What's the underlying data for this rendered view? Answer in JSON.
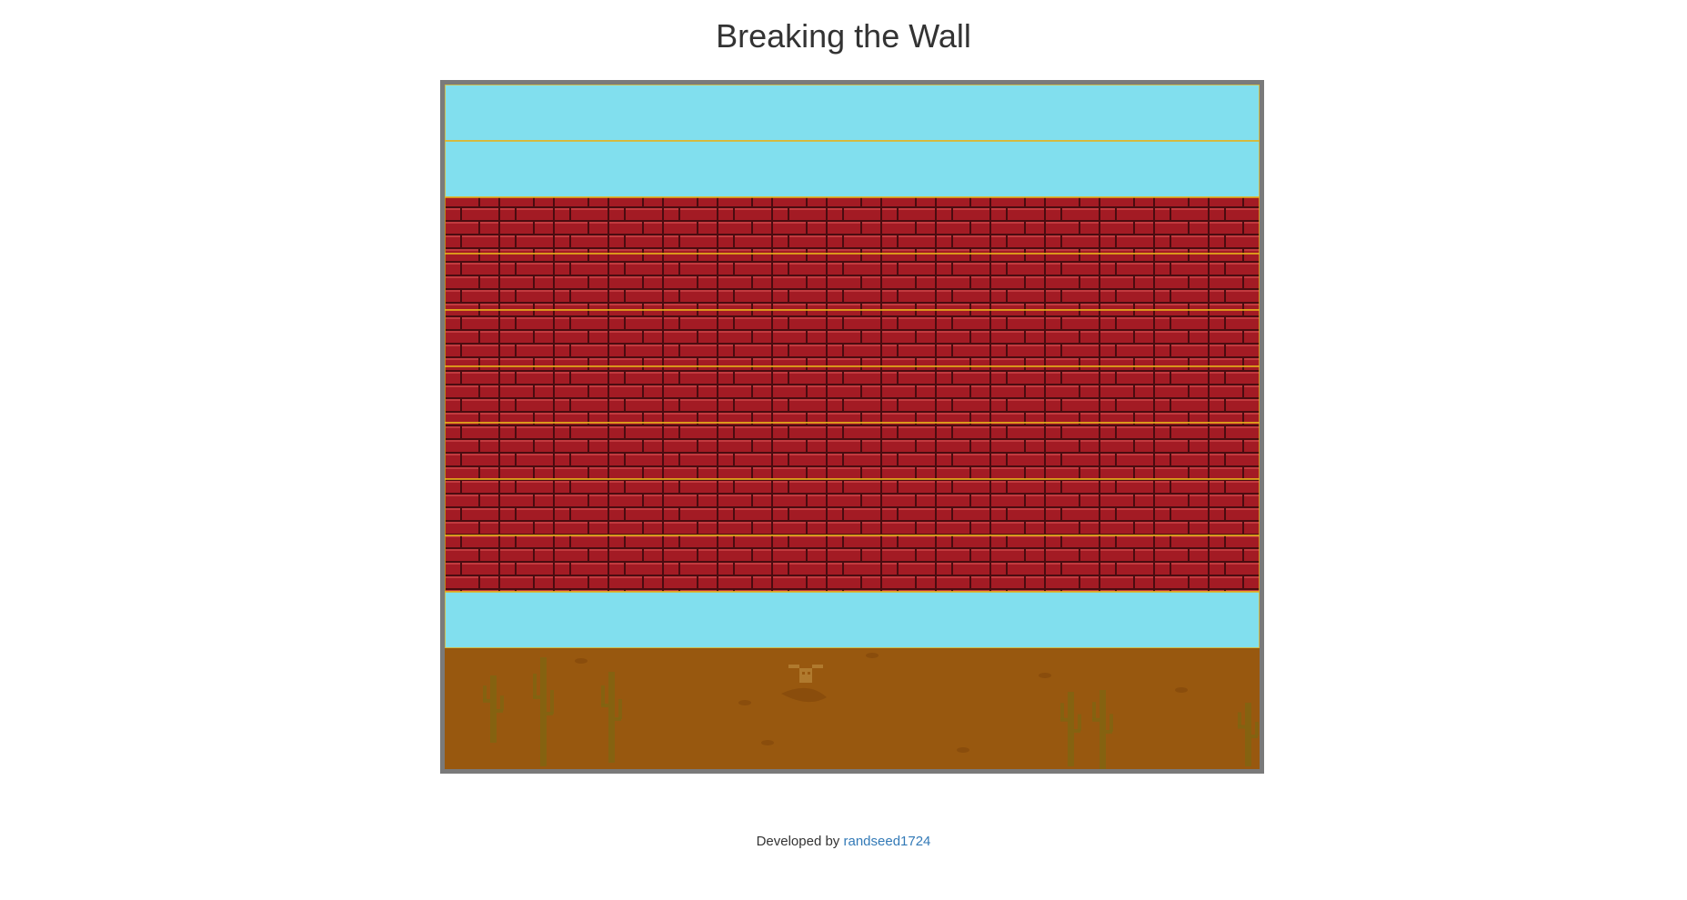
{
  "page": {
    "title": "Breaking the Wall"
  },
  "game": {
    "colors": {
      "sky": "#81dfee",
      "row_border": "#e6b21a",
      "brick": "#a31b24",
      "brick_highlight": "#c23a3f",
      "mortar": "#4a0c10",
      "ground": "#98580f",
      "ground_detail": "#8a4d0c",
      "cactus": "#7f6512",
      "frame": "#7a7a7a"
    },
    "rows": [
      {
        "type": "sky"
      },
      {
        "type": "sky"
      },
      {
        "type": "brick"
      },
      {
        "type": "brick"
      },
      {
        "type": "brick"
      },
      {
        "type": "brick"
      },
      {
        "type": "brick"
      },
      {
        "type": "brick"
      },
      {
        "type": "brick"
      },
      {
        "type": "sky"
      },
      {
        "type": "ground"
      }
    ],
    "decorations": [
      "cactus-icon",
      "cow-skull-icon",
      "stone-icon"
    ]
  },
  "footer": {
    "prefix": "Developed by",
    "author": "randseed1724"
  }
}
